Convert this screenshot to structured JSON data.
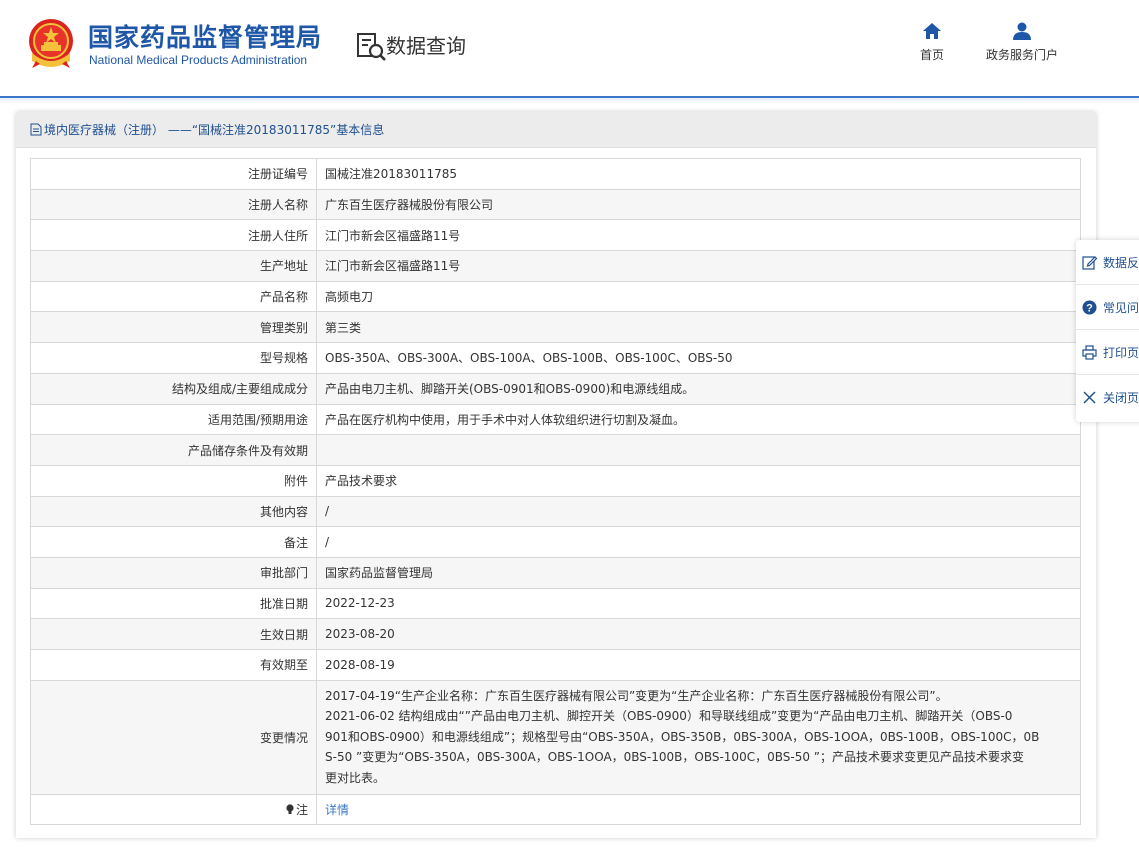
{
  "header": {
    "brand_cn": "国家药品监督管理局",
    "brand_en": "National Medical Products Administration",
    "query_label": "数据查询",
    "nav": [
      {
        "label": "首页",
        "icon": "home-icon"
      },
      {
        "label": "政务服务门户",
        "icon": "user-icon"
      }
    ]
  },
  "panel": {
    "title": "境内医疗器械（注册） ——“国械注准20183011785”基本信息"
  },
  "rows": [
    {
      "key": "注册证编号",
      "value": "国械注准20183011785"
    },
    {
      "key": "注册人名称",
      "value": "广东百生医疗器械股份有限公司"
    },
    {
      "key": "注册人住所",
      "value": "江门市新会区福盛路11号"
    },
    {
      "key": "生产地址",
      "value": "江门市新会区福盛路11号"
    },
    {
      "key": "产品名称",
      "value": "高频电刀"
    },
    {
      "key": "管理类别",
      "value": "第三类"
    },
    {
      "key": "型号规格",
      "value": "OBS-350A、OBS-300A、OBS-100A、OBS-100B、OBS-100C、OBS-50"
    },
    {
      "key": "结构及组成/主要组成成分",
      "value": "产品由电刀主机、脚踏开关(OBS-0901和OBS-0900)和电源线组成。"
    },
    {
      "key": "适用范围/预期用途",
      "value": "产品在医疗机构中使用，用于手术中对人体软组织进行切割及凝血。"
    },
    {
      "key": "产品储存条件及有效期",
      "value": ""
    },
    {
      "key": "附件",
      "value": "产品技术要求"
    },
    {
      "key": "其他内容",
      "value": "/"
    },
    {
      "key": "备注",
      "value": "/"
    },
    {
      "key": "审批部门",
      "value": "国家药品监督管理局"
    },
    {
      "key": "批准日期",
      "value": "2022-12-23"
    },
    {
      "key": "生效日期",
      "value": "2023-08-20"
    },
    {
      "key": "有效期至",
      "value": "2028-08-19"
    }
  ],
  "change": {
    "key": "变更情况",
    "lines": [
      "2017-04-19“生产企业名称：广东百生医疗器械有限公司”变更为“生产企业名称：广东百生医疗器械股份有限公司”。",
      "2021-06-02 结构组成由“”产品由电刀主机、脚控开关（OBS-0900）和导联线组成”变更为“产品由电刀主机、脚踏开关（OBS-0",
      "901和OBS-0900）和电源线组成”；规格型号由“OBS-350A，OBS-350B，0BS-300A，OBS-1OOA，0BS-100B，OBS-100C，0B",
      "S-50 ”变更为“OBS-350A，0BS-300A，OBS-1OOA，0BS-100B，OBS-100C，0BS-50 ”；产品技术要求变更见产品技术要求变",
      "更对比表。"
    ]
  },
  "note": {
    "key": "注",
    "value": "详情"
  },
  "sidebar": [
    {
      "label": "数据反",
      "icon": "edit-icon"
    },
    {
      "label": "常见问",
      "icon": "question-icon"
    },
    {
      "label": "打印页",
      "icon": "print-icon"
    },
    {
      "label": "关闭页",
      "icon": "close-icon"
    }
  ]
}
